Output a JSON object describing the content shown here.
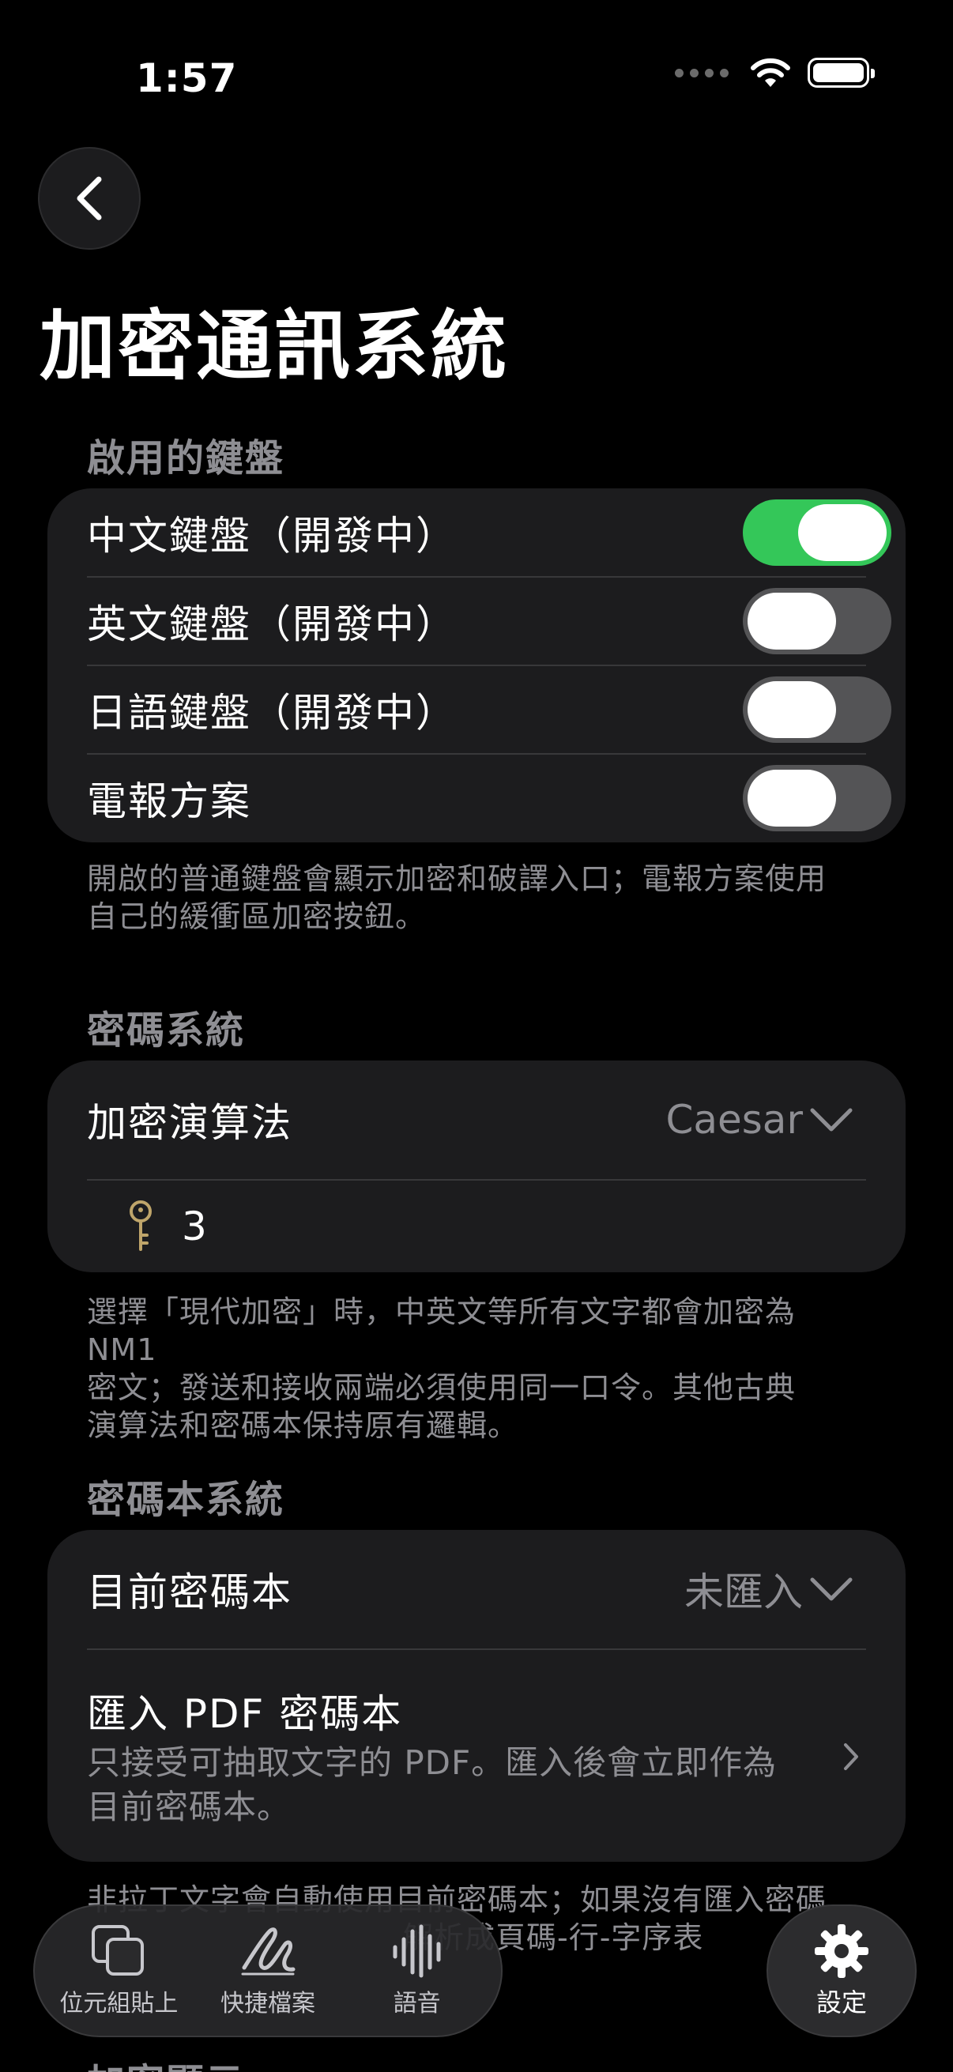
{
  "status_bar": {
    "time": "1:57"
  },
  "page": {
    "title": "加密通訊系統"
  },
  "keyboards": {
    "header": "啟用的鍵盤",
    "items": [
      {
        "label": "中文鍵盤（開發中）",
        "enabled": true
      },
      {
        "label": "英文鍵盤（開發中）",
        "enabled": false
      },
      {
        "label": "日語鍵盤（開發中）",
        "enabled": false
      },
      {
        "label": "電報方案",
        "enabled": false
      }
    ],
    "footer_line1": "開啟的普通鍵盤會顯示加密和破譯入口；電報方案使用",
    "footer_line2": "自己的緩衝區加密按鈕。"
  },
  "cipher": {
    "header": "密碼系統",
    "algorithm_label": "加密演算法",
    "algorithm_value": "Caesar",
    "key_value": "3",
    "footer_line1": "選擇「現代加密」時，中英文等所有文字都會加密為 NM1",
    "footer_line2": "密文；發送和接收兩端必須使用同一口令。其他古典",
    "footer_line3": "演算法和密碼本保持原有邏輯。"
  },
  "codebook": {
    "header": "密碼本系統",
    "current_label": "目前密碼本",
    "current_value": "未匯入",
    "import_title": "匯入 PDF 密碼本",
    "import_desc_line1": "只接受可抽取文字的 PDF。匯入後會立即作為",
    "import_desc_line2": "目前密碼本。",
    "footer_line1": "非拉丁文字會自動使用目前密碼本；如果沒有匯入密碼",
    "footer_line2": "解析成頁碼-行-字序表"
  },
  "next_section": {
    "header": "加密顯示"
  },
  "tabbar": {
    "tabs": [
      {
        "label": "位元組貼上"
      },
      {
        "label": "快捷檔案"
      },
      {
        "label": "語音"
      }
    ],
    "settings_label": "設定"
  }
}
